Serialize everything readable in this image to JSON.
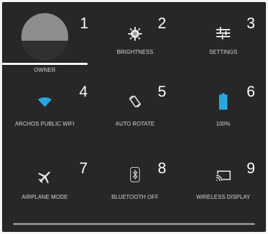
{
  "tiles": [
    {
      "id": "owner",
      "label": "OWNER",
      "number": "1"
    },
    {
      "id": "brightness",
      "label": "BRIGHTNESS",
      "number": "2"
    },
    {
      "id": "settings",
      "label": "SETTINGS",
      "number": "3"
    },
    {
      "id": "wifi",
      "label": "ARCHOS PUBLIC WIFI",
      "number": "4"
    },
    {
      "id": "auto_rotate",
      "label": "AUTO ROTATE",
      "number": "5"
    },
    {
      "id": "battery",
      "label": "100%",
      "number": "6"
    },
    {
      "id": "airplane",
      "label": "AIRPLANE MODE",
      "number": "7"
    },
    {
      "id": "bluetooth",
      "label": "BLUETOOTH OFF",
      "number": "8"
    },
    {
      "id": "wireless_display",
      "label": "WIRELESS DISPLAY",
      "number": "9"
    }
  ],
  "icons": {
    "owner": "avatar-icon",
    "brightness": "brightness-icon",
    "settings": "settings-sliders-icon",
    "wifi": "wifi-icon",
    "auto_rotate": "rotate-icon",
    "battery": "battery-icon",
    "airplane": "airplane-icon",
    "bluetooth": "bluetooth-icon",
    "wireless_display": "cast-icon"
  },
  "colors": {
    "panel": "#272727",
    "wifi_accent": "#27a7e0",
    "battery_accent": "#27a7e0",
    "label": "#d6d6d6"
  },
  "battery_level_percent": 100
}
